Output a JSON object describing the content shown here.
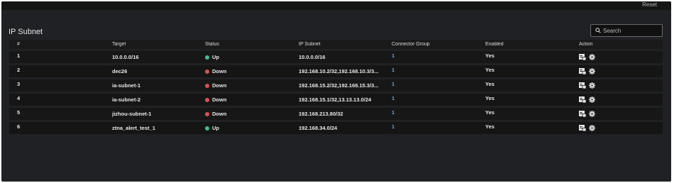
{
  "topbar": {
    "reset_label": "Reset"
  },
  "page": {
    "title": "IP Subnet"
  },
  "search": {
    "placeholder": "Search",
    "value": ""
  },
  "table": {
    "columns": {
      "num": "#",
      "target": "Target",
      "status": "Status",
      "ip_subnet": "IP Subnet",
      "connector_group": "Connector Group",
      "enabled": "Enabled",
      "action": "Action"
    },
    "rows": [
      {
        "num": "1",
        "target": "10.0.0.0/16",
        "status": "Up",
        "ip_subnet": "10.0.0.0/16",
        "connector_group": "1",
        "enabled": "Yes"
      },
      {
        "num": "2",
        "target": "dec26",
        "status": "Down",
        "ip_subnet": "192.168.10.2/32,192.168.10.3/3...",
        "connector_group": "1",
        "enabled": "Yes"
      },
      {
        "num": "3",
        "target": "ia-subnet-1",
        "status": "Down",
        "ip_subnet": "192.168.15.2/32,192.168.15.3/3...",
        "connector_group": "1",
        "enabled": "Yes"
      },
      {
        "num": "4",
        "target": "ia-subnet-2",
        "status": "Down",
        "ip_subnet": "192.168.15.1/32,13.13.13.0/24",
        "connector_group": "1",
        "enabled": "Yes"
      },
      {
        "num": "5",
        "target": "jizhou-subnet-1",
        "status": "Down",
        "ip_subnet": "192.168.213.80/32",
        "connector_group": "1",
        "enabled": "Yes"
      },
      {
        "num": "6",
        "target": "ztna_alert_test_1",
        "status": "Up",
        "ip_subnet": "192.168.34.0/24",
        "connector_group": "1",
        "enabled": "Yes"
      }
    ]
  },
  "colors": {
    "status_up": "#3fbf8a",
    "status_down": "#d9534f",
    "link": "#5aa0ff",
    "background": "#202124"
  },
  "icons": {
    "search": "search-icon",
    "edit": "edit-icon",
    "settings": "gear-icon"
  }
}
